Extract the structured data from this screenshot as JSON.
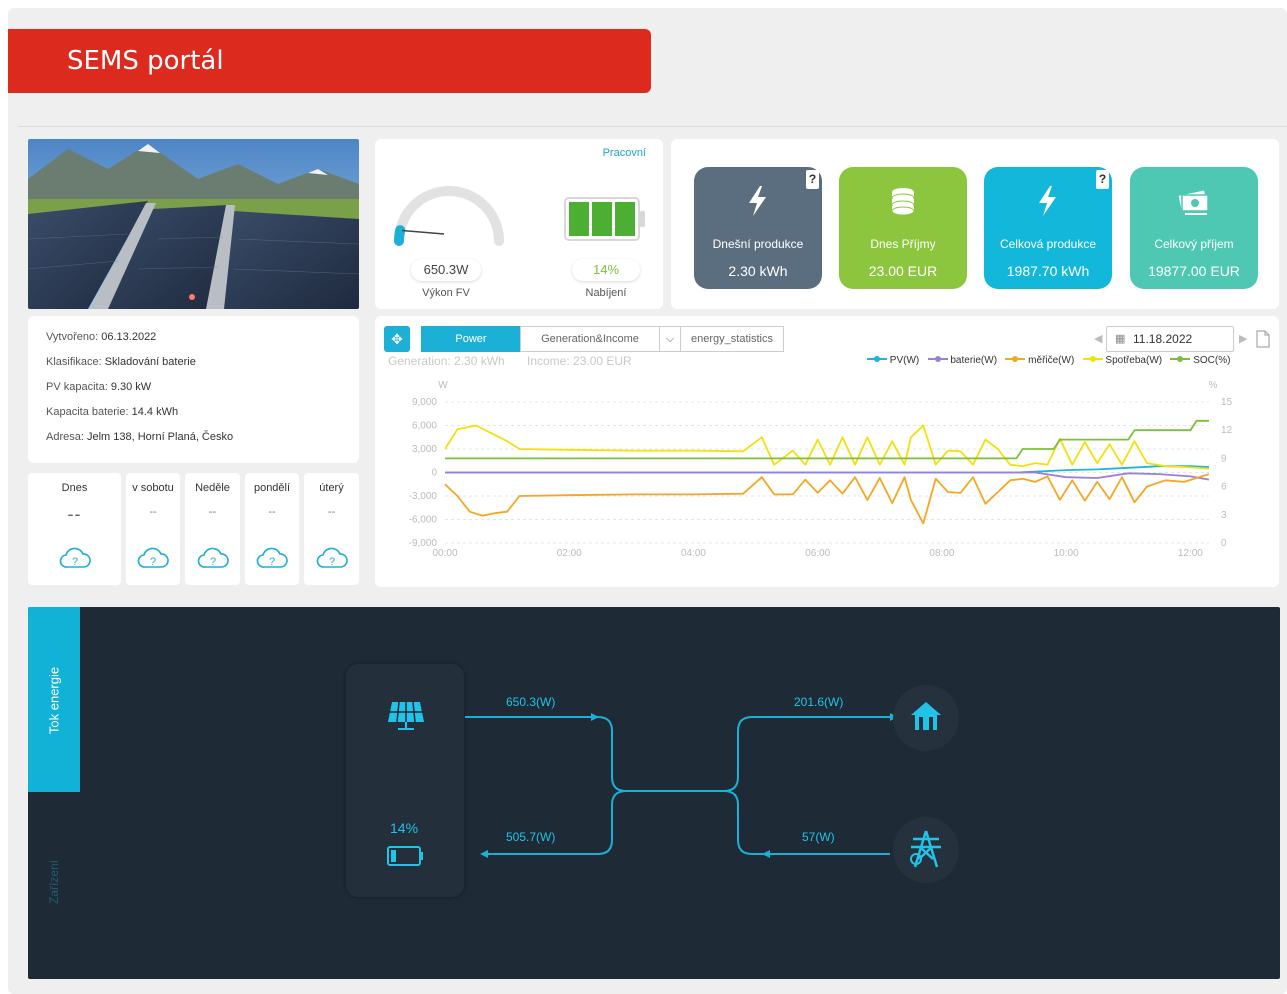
{
  "banner": {
    "title": "SEMS portál"
  },
  "plant_info": {
    "created_label": "Vytvořeno:",
    "created": "06.13.2022",
    "class_label": "Klasifikace:",
    "class": "Skladování baterie",
    "pv_label": "PV kapacita:",
    "pv": "9.30 kW",
    "battery_label": "Kapacita baterie:",
    "battery": "14.4 kWh",
    "address_label": "Adresa:",
    "address": "Jelm 138, Horní Planá, Česko"
  },
  "weather": [
    {
      "day": "Dnes",
      "value": "--",
      "icon": "cloud-question-icon"
    },
    {
      "day": "v sobotu",
      "value": "--",
      "icon": "cloud-question-icon"
    },
    {
      "day": "Neděle",
      "value": "--",
      "icon": "cloud-question-icon"
    },
    {
      "day": "pondělí",
      "value": "--",
      "icon": "cloud-question-icon"
    },
    {
      "day": "úterý",
      "value": "--",
      "icon": "cloud-question-icon"
    }
  ],
  "gauge": {
    "status": "Pracovní",
    "power_value": "650.3W",
    "power_label": "Výkon FV",
    "soc_value": "14%",
    "soc_label": "Nabíjení",
    "gauge_level": 0.07,
    "battery_level": 0.14
  },
  "tiles": [
    {
      "label": "Dnešní produkce",
      "value": "2.30 kWh",
      "color": "#5b6e80",
      "icon": "bolt-icon",
      "help": "?"
    },
    {
      "label": "Dnes Příjmy",
      "value": "23.00 EUR",
      "color": "#8cc63e",
      "icon": "coins-icon",
      "help": ""
    },
    {
      "label": "Celková produkce",
      "value": "1987.70 kWh",
      "color": "#12b7da",
      "icon": "bolt-icon",
      "help": "?"
    },
    {
      "label": "Celkový příjem",
      "value": "19877.00 EUR",
      "color": "#4ec8b2",
      "icon": "cash-icon",
      "help": ""
    }
  ],
  "chart_panel": {
    "tabs": [
      "Power",
      "Generation&Income",
      "energy_statistics"
    ],
    "generation": "Generation: 2.30 kWh",
    "income": "Income: 23.00 EUR",
    "date": "11.18.2022"
  },
  "chart_data": {
    "type": "line",
    "x_ticks": [
      "00:00",
      "02:00",
      "04:00",
      "06:00",
      "08:00",
      "10:00",
      "12:00"
    ],
    "y_left_unit": "W",
    "y_right_unit": "%",
    "ylim": [
      -9000,
      9000
    ],
    "y2lim": [
      0,
      15
    ],
    "y_ticks": [
      "9,000",
      "6,000",
      "3,000",
      "0",
      "-3,000",
      "-6,000",
      "-9,000"
    ],
    "y2_ticks": [
      "15",
      "12",
      "9",
      "6",
      "3",
      "0"
    ],
    "legend_position": "top-right",
    "series": [
      {
        "name": "PV(W)",
        "color": "#1cb6d6",
        "axis": "left",
        "points": [
          [
            0,
            0
          ],
          [
            9.2,
            0
          ],
          [
            9.5,
            100
          ],
          [
            10,
            300
          ],
          [
            10.5,
            400
          ],
          [
            11,
            600
          ],
          [
            11.5,
            800
          ],
          [
            12,
            800
          ],
          [
            12.3,
            700
          ]
        ]
      },
      {
        "name": "baterie(W)",
        "color": "#9a7fd6",
        "axis": "left",
        "points": [
          [
            0,
            0
          ],
          [
            9.5,
            0
          ],
          [
            10,
            -600
          ],
          [
            10.5,
            -700
          ],
          [
            11,
            -100
          ],
          [
            11.5,
            -200
          ],
          [
            12,
            -500
          ],
          [
            12.3,
            -900
          ]
        ]
      },
      {
        "name": "měřiče(W)",
        "color": "#f5a623",
        "axis": "left",
        "points": [
          [
            0,
            -1500
          ],
          [
            0.2,
            -3000
          ],
          [
            0.4,
            -5000
          ],
          [
            0.6,
            -5500
          ],
          [
            0.8,
            -5200
          ],
          [
            1,
            -5000
          ],
          [
            1.2,
            -3000
          ],
          [
            2,
            -2900
          ],
          [
            3,
            -2800
          ],
          [
            4,
            -2800
          ],
          [
            4.8,
            -2700
          ],
          [
            5.1,
            -600
          ],
          [
            5.3,
            -2800
          ],
          [
            5.6,
            -2800
          ],
          [
            5.8,
            -900
          ],
          [
            6,
            -2600
          ],
          [
            6.2,
            -1000
          ],
          [
            6.4,
            -2700
          ],
          [
            6.6,
            -600
          ],
          [
            6.8,
            -3500
          ],
          [
            7,
            -700
          ],
          [
            7.2,
            -3900
          ],
          [
            7.4,
            -600
          ],
          [
            7.5,
            -3500
          ],
          [
            7.7,
            -6500
          ],
          [
            7.9,
            -800
          ],
          [
            8.1,
            -2500
          ],
          [
            8.3,
            -2600
          ],
          [
            8.5,
            -600
          ],
          [
            8.7,
            -4000
          ],
          [
            8.9,
            -2500
          ],
          [
            9.1,
            -1000
          ],
          [
            9.3,
            -800
          ],
          [
            9.5,
            -1200
          ],
          [
            9.7,
            -500
          ],
          [
            9.9,
            -3500
          ],
          [
            10.1,
            -1000
          ],
          [
            10.3,
            -3600
          ],
          [
            10.5,
            -1200
          ],
          [
            10.7,
            -3400
          ],
          [
            10.9,
            -600
          ],
          [
            11.1,
            -3800
          ],
          [
            11.3,
            -1800
          ],
          [
            11.6,
            -1000
          ],
          [
            11.9,
            -1200
          ],
          [
            12.3,
            -200
          ]
        ]
      },
      {
        "name": "Spotřeba(W)",
        "color": "#f2e10a",
        "axis": "left",
        "points": [
          [
            0,
            3000
          ],
          [
            0.2,
            5500
          ],
          [
            0.5,
            6000
          ],
          [
            1,
            4000
          ],
          [
            1.2,
            3000
          ],
          [
            2,
            2900
          ],
          [
            3,
            2800
          ],
          [
            4,
            2800
          ],
          [
            4.8,
            2700
          ],
          [
            5.1,
            4500
          ],
          [
            5.3,
            1000
          ],
          [
            5.6,
            2800
          ],
          [
            5.8,
            1000
          ],
          [
            6,
            4200
          ],
          [
            6.2,
            1000
          ],
          [
            6.4,
            4500
          ],
          [
            6.6,
            1000
          ],
          [
            6.8,
            4500
          ],
          [
            7,
            1000
          ],
          [
            7.2,
            4000
          ],
          [
            7.4,
            1000
          ],
          [
            7.5,
            4500
          ],
          [
            7.7,
            6000
          ],
          [
            7.9,
            1000
          ],
          [
            8.1,
            2800
          ],
          [
            8.3,
            2700
          ],
          [
            8.5,
            1000
          ],
          [
            8.7,
            4200
          ],
          [
            8.9,
            3000
          ],
          [
            9.1,
            1000
          ],
          [
            9.3,
            800
          ],
          [
            9.5,
            1200
          ],
          [
            9.7,
            1000
          ],
          [
            9.9,
            4300
          ],
          [
            10.1,
            1000
          ],
          [
            10.3,
            3900
          ],
          [
            10.5,
            1200
          ],
          [
            10.7,
            3600
          ],
          [
            10.9,
            1000
          ],
          [
            11.1,
            4000
          ],
          [
            11.3,
            1200
          ],
          [
            11.6,
            800
          ],
          [
            11.9,
            700
          ],
          [
            12.3,
            500
          ]
        ]
      },
      {
        "name": "SOC(%)",
        "color": "#7cbf3b",
        "axis": "right",
        "points": [
          [
            0,
            9
          ],
          [
            9.2,
            9
          ],
          [
            9.3,
            10
          ],
          [
            9.8,
            10
          ],
          [
            9.9,
            11
          ],
          [
            11,
            11
          ],
          [
            11.1,
            12
          ],
          [
            12,
            12
          ],
          [
            12.1,
            13
          ],
          [
            12.3,
            13
          ]
        ]
      }
    ]
  },
  "flow": {
    "side_tab_active": "Tok energie",
    "side_tab_inactive": "Zařízení",
    "pv_flow": "650.3(W)",
    "home_flow": "201.6(W)",
    "battery_flow": "505.7(W)",
    "grid_flow": "57(W)",
    "battery_soc": "14%"
  }
}
